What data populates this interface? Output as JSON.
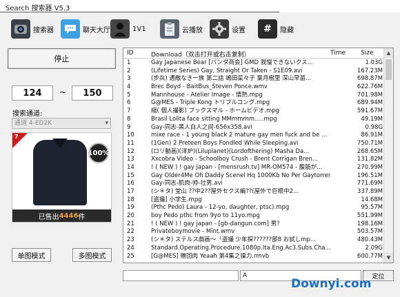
{
  "window": {
    "title": "Search 搜索器 V5.3"
  },
  "toolbar": {
    "items": [
      {
        "label": "搜索器",
        "icon": "webcam-icon",
        "color": "#3a4048"
      },
      {
        "label": "聊天大厅",
        "icon": "chat-bubble-icon",
        "color": "#3fa0e0"
      },
      {
        "label": "1V1",
        "icon": "person-silhouette-icon",
        "color": "#444444"
      },
      {
        "label": "云播放",
        "icon": "clipboard-icon",
        "color": "#5a6470"
      },
      {
        "label": "设置",
        "icon": "gear-icon",
        "color": "#3a3a3a"
      },
      {
        "label": "隐藏",
        "icon": "hash-icon",
        "color": "#2a2a2a"
      }
    ]
  },
  "controls": {
    "stop_label": "停止",
    "range_from": "124",
    "range_sep": "~",
    "range_to": "150",
    "channel_label": "搜索通道:",
    "channel_value": "通道 4-ED2K",
    "single_mode_label": "单图模式",
    "multi_mode_label": "多图模式"
  },
  "ad": {
    "corner_number": "7",
    "badge_text": "100%",
    "sold_prefix": "已售出",
    "sold_count": "4446",
    "sold_suffix": "件"
  },
  "list": {
    "columns": {
      "id": "ID",
      "download": "Download（双击打开或右击复制）",
      "time": "Time",
      "size": "Size"
    },
    "rows": [
      {
        "id": "1",
        "name": "Gay Japanese Bear  [パンダ商会] GMD 我慢できないクス...",
        "size": "1.03G"
      },
      {
        "id": "2",
        "name": "(Lifetime Series) Gay, Straight Or Taken - S1E09.avi",
        "size": "167.23M"
      },
      {
        "id": "3",
        "name": "(步兵) 遇敵なき一族 第二話 嶋田菜々子 葉月樹里 深山早苗...",
        "size": "698.87M"
      },
      {
        "id": "4",
        "name": "Brec Boyd - BaitBus_Steven Ponce.wmv",
        "size": "622.76M"
      },
      {
        "id": "5",
        "name": "Mannhouse - Atelier Image - 情熱.mpg",
        "size": "701.98M"
      },
      {
        "id": "6",
        "name": "G@MES - Triple Kong トリプルコング.mpg",
        "size": "689.94M"
      },
      {
        "id": "7",
        "name": "縮( 個人撮影) プックスマル - ホームビデオ.mpg",
        "size": "591.67M"
      },
      {
        "id": "8",
        "name": "Brasil Lolita face sitting MMmmmm.....mpg",
        "size": "49.19M"
      },
      {
        "id": "9",
        "name": "Gay-同志-黑人白人之间-656x358.avi",
        "size": "0.98G"
      },
      {
        "id": "10",
        "name": "mixe race - 1 young black 2 mature gay men fuck and be ...",
        "size": "86.91M"
      },
      {
        "id": "11",
        "name": "(1Gen) 2 Preteen Boys Fondled While Sleeping.avi",
        "size": "750.71M"
      },
      {
        "id": "12",
        "name": "(ロリ動画)(洋炉)(Liluplanet)(Lordofthering) Masha Da...",
        "size": "268.65M"
      },
      {
        "id": "13",
        "name": "Xxcobra Video - Schoolboy Crush - Brent Corrigan  Bren...",
        "size": "131.82M"
      },
      {
        "id": "14",
        "name": "! ( NEW ) ! gay japan - [mensrush.tv] MR-OM574 - 腹筋が...",
        "size": "270.99M"
      },
      {
        "id": "15",
        "name": "Gay Older4Me Oh Daddy Scenel Hq 1000Kb No Per Gaytorren...",
        "size": "196.51M"
      },
      {
        "id": "16",
        "name": "Gay-同志-肌肉-帅-壮男.avi",
        "size": "771.69M"
      },
      {
        "id": "17",
        "name": "(シ＊タ) 堂山 ??中2??屋外セクス編??(屋外で巨根中2...",
        "size": "337.89M"
      },
      {
        "id": "18",
        "name": "[盗撮] 小学生.mpg",
        "size": "14.68M"
      },
      {
        "id": "19",
        "name": "(Pthc Pedo) Laura - 12-yo, daughter, ptsc).mpg",
        "size": "95.57M"
      },
      {
        "id": "20",
        "name": "boy Pedo pthc from 9yo to 11yo.mpg",
        "size": "551.99M"
      },
      {
        "id": "21",
        "name": "! ( NEW ) ! gay japan - [gb-dangun.com] 男?",
        "size": "198.16M"
      },
      {
        "id": "22",
        "name": "Privateboymovie - Mint.wmv",
        "size": "503.57M"
      },
      {
        "id": "23",
        "name": "(シ＊タ) ステルス戯画～「盗撮 少年探??????部8 お試しmp...",
        "size": "480.43M"
      },
      {
        "id": "24",
        "name": "Standard.Operating.Procedure.1080p.Ita.Eng.Ac3.Subs.Cha...",
        "size": "2.09G"
      },
      {
        "id": "25",
        "name": "[G@MES] 贈回肉 Yeaah 第4集之操力.rmvb",
        "size": "600.77M"
      }
    ]
  },
  "status": {
    "left_value": "",
    "right_value": "A",
    "locate_label": "定位"
  },
  "watermark": "Downyi.com"
}
